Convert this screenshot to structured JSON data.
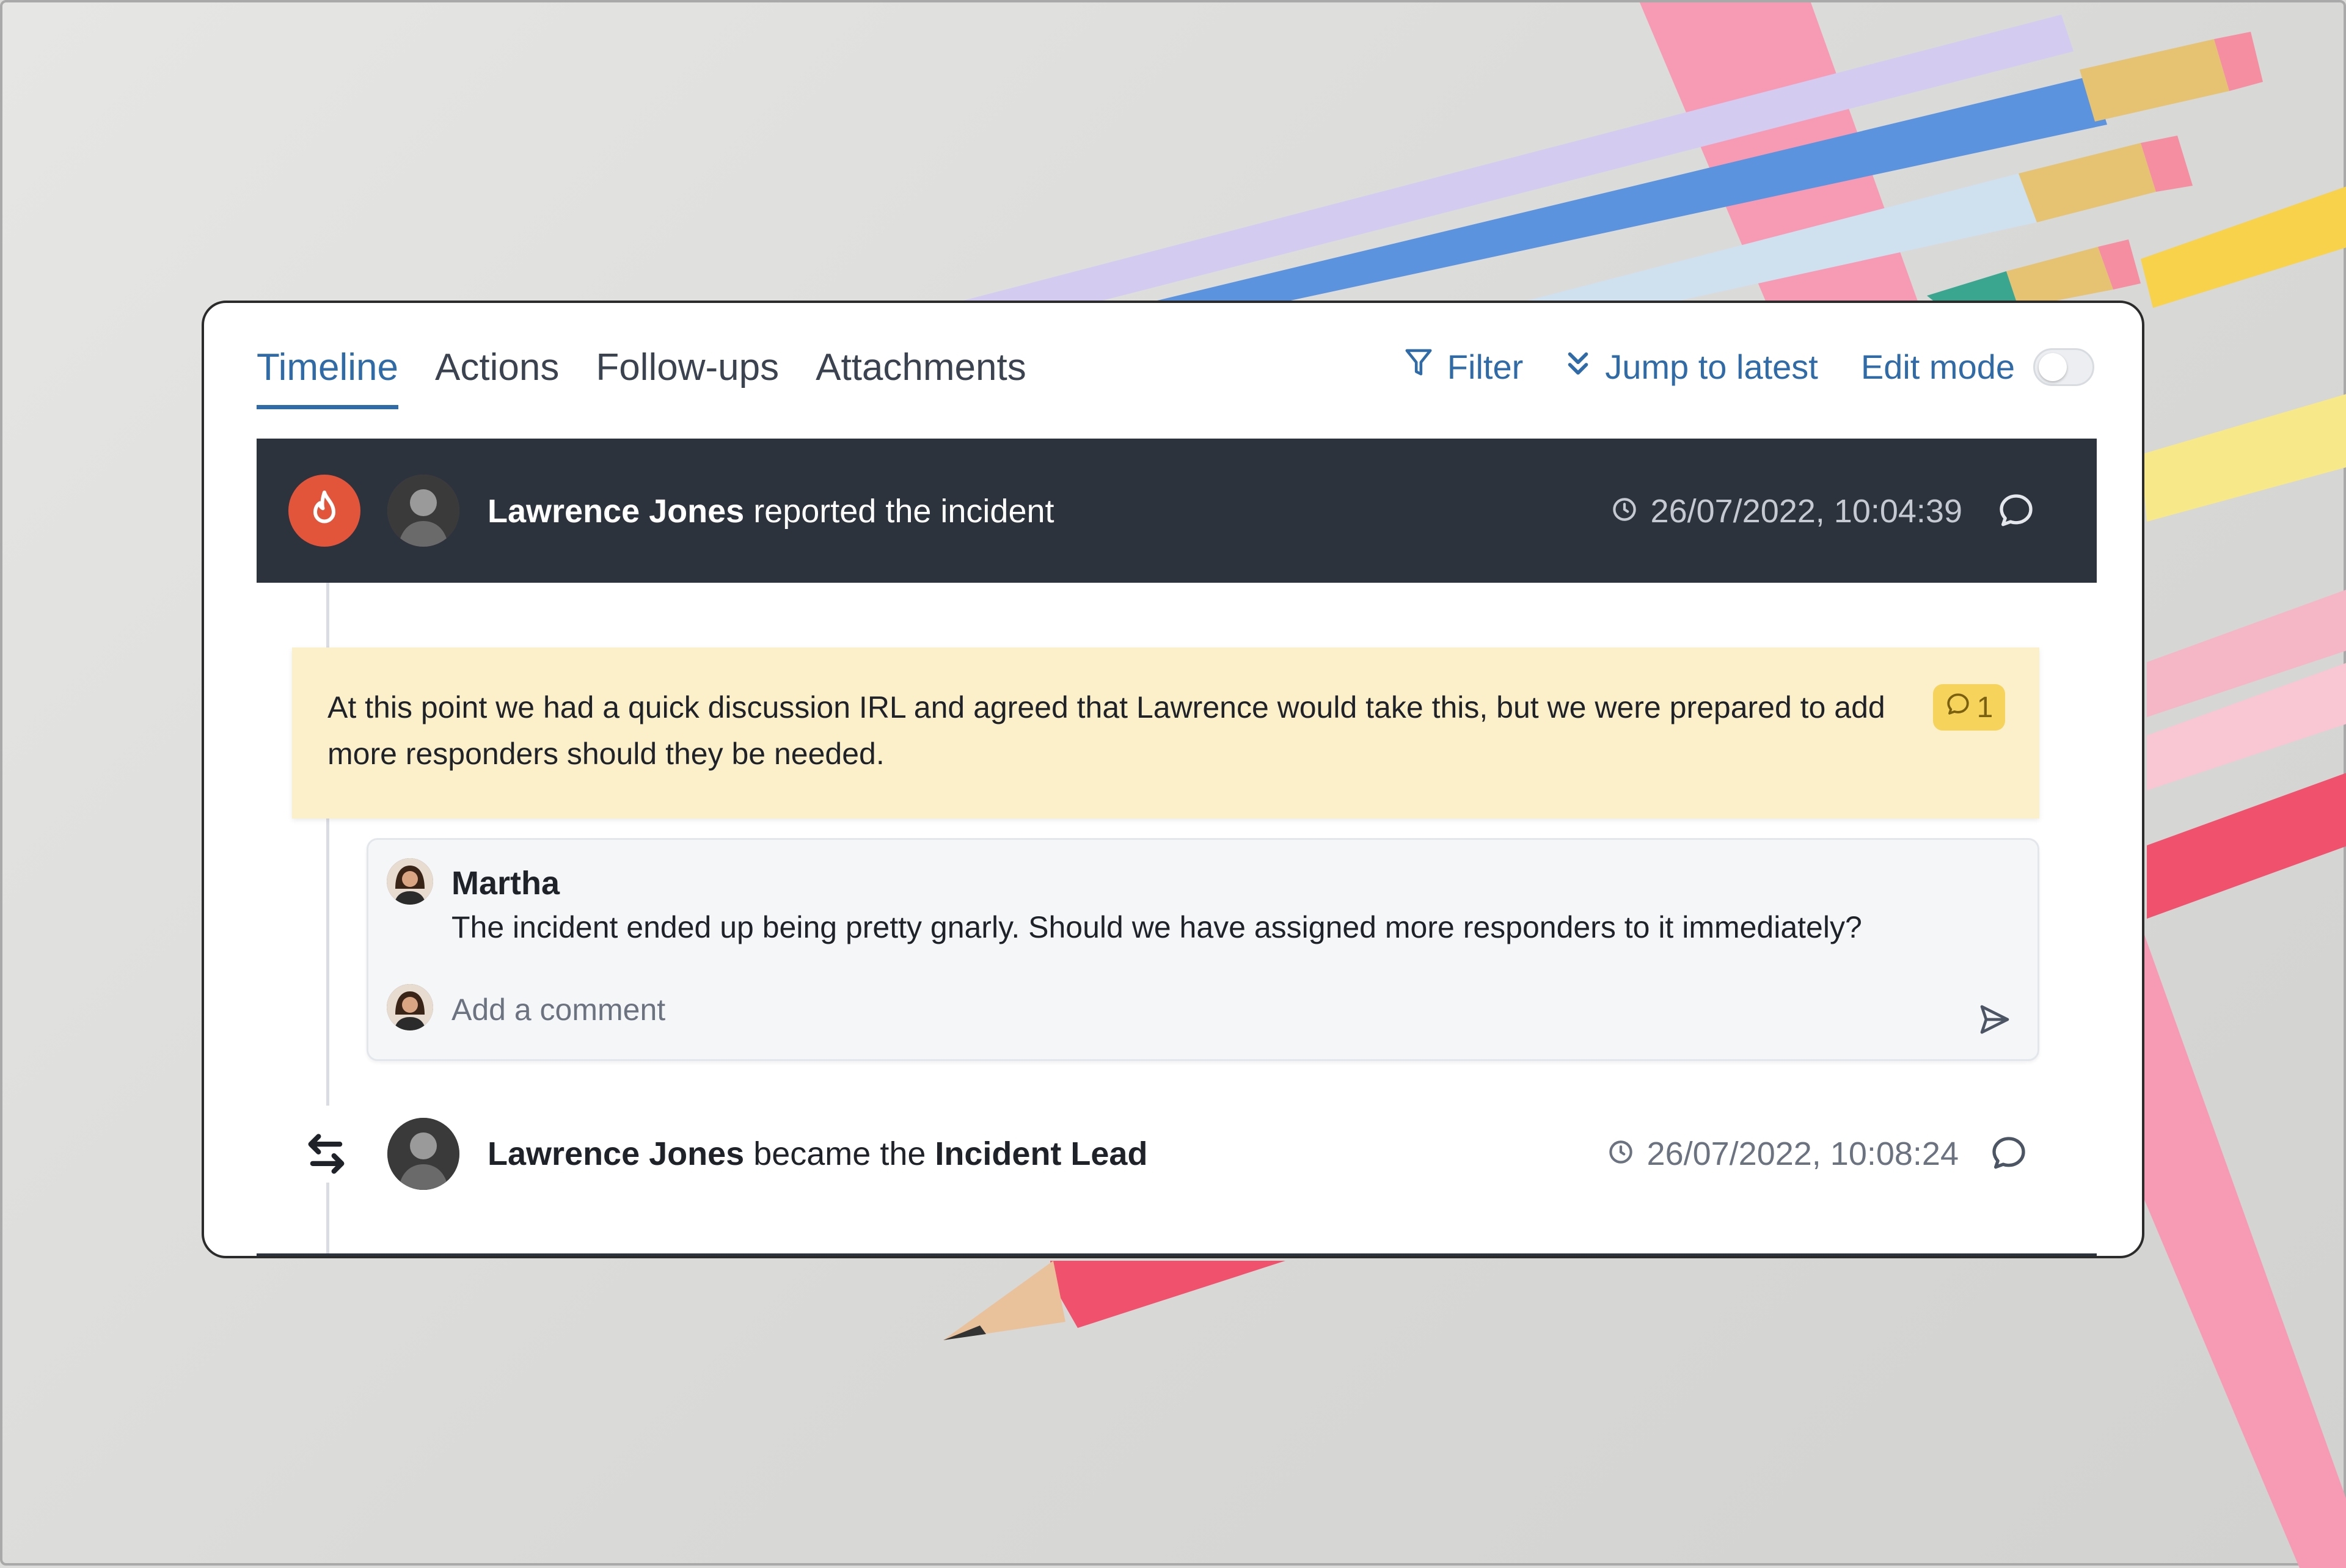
{
  "tabs": [
    {
      "label": "Timeline",
      "active": true
    },
    {
      "label": "Actions",
      "active": false
    },
    {
      "label": "Follow-ups",
      "active": false
    },
    {
      "label": "Attachments",
      "active": false
    }
  ],
  "toolbar": {
    "filter_label": "Filter",
    "jump_label": "Jump to latest",
    "edit_mode_label": "Edit mode",
    "edit_mode_on": false
  },
  "events": [
    {
      "actor": "Lawrence Jones",
      "action": "reported the incident",
      "timestamp": "26/07/2022, 10:04:39",
      "icon": "fire-icon"
    },
    {
      "actor": "Lawrence Jones",
      "action": "became the",
      "role": "Incident Lead",
      "timestamp": "26/07/2022, 10:08:24",
      "icon": "swap-arrows-icon"
    }
  ],
  "note": {
    "text": "At this point we had a quick discussion IRL and agreed that Lawrence would take this, but we were prepared to add more responders should they be needed.",
    "comment_count": "1"
  },
  "comment": {
    "author": "Martha",
    "body": "The incident ended up being pretty gnarly. Should we have assigned more responders to it immediately?",
    "input_placeholder": "Add a comment"
  },
  "colors": {
    "accent": "#2f6ba8",
    "header_bg": "#2d333d",
    "fire_badge": "#e2553b",
    "note_bg": "#fbf0c9",
    "note_badge": "#f6d35b"
  }
}
